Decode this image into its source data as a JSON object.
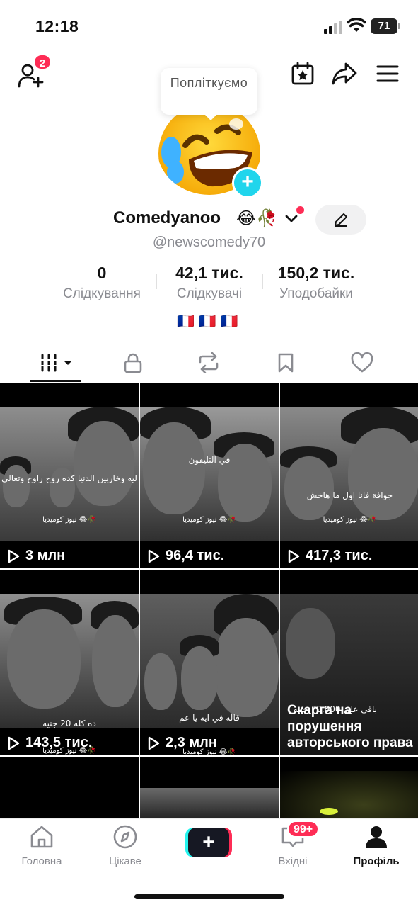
{
  "status_bar": {
    "time": "12:18",
    "battery": "71"
  },
  "header": {
    "friend_requests_badge": "2",
    "icons": [
      "add-friend-icon",
      "calendar-star-icon",
      "share-icon",
      "menu-icon"
    ]
  },
  "profile": {
    "tooltip": "Попліткуємо",
    "display_name": "Comedyanoo",
    "name_emoji": "😂🥀",
    "username": "@newscomedy70",
    "flags": "🇫🇷🇫🇷🇫🇷"
  },
  "stats": [
    {
      "value": "0",
      "label": "Слідкування"
    },
    {
      "value": "42,1 тис.",
      "label": "Слідкувачі"
    },
    {
      "value": "150,2 тис.",
      "label": "Уподобайки"
    }
  ],
  "tabs": [
    "videos-grid",
    "private",
    "reposts",
    "favorites",
    "liked"
  ],
  "videos": [
    {
      "views": "3 млн",
      "caption": "ليه وخاربين الدنيا كده روح راوح وتعالى",
      "tag": "نيوز كوميديا 😂🥀"
    },
    {
      "views": "96,4 тис.",
      "caption": "في التليفون",
      "tag": "نيوز كوميديا 😂🥀"
    },
    {
      "views": "417,3 тис.",
      "caption": "جوافة فانا اول ما هاخش",
      "tag": "نيوز كوميديا 😂🥀"
    },
    {
      "views": "143,5 тис.",
      "caption": "ده كله 20 جنيه",
      "tag": "نيوز كوميديا 😂🥀"
    },
    {
      "views": "2,3 млн",
      "caption": "قاله في ايه يا عم",
      "tag": "نيوز كوميديا 😂🥀"
    },
    {
      "copyright_notice": "Скарга на порушення авторського права",
      "caption": "باقي علي 70,000 جنيه"
    }
  ],
  "bottom_nav": {
    "home": "Головна",
    "discover": "Цікаве",
    "inbox": "Вхідні",
    "inbox_badge": "99+",
    "profile": "Профіль"
  }
}
